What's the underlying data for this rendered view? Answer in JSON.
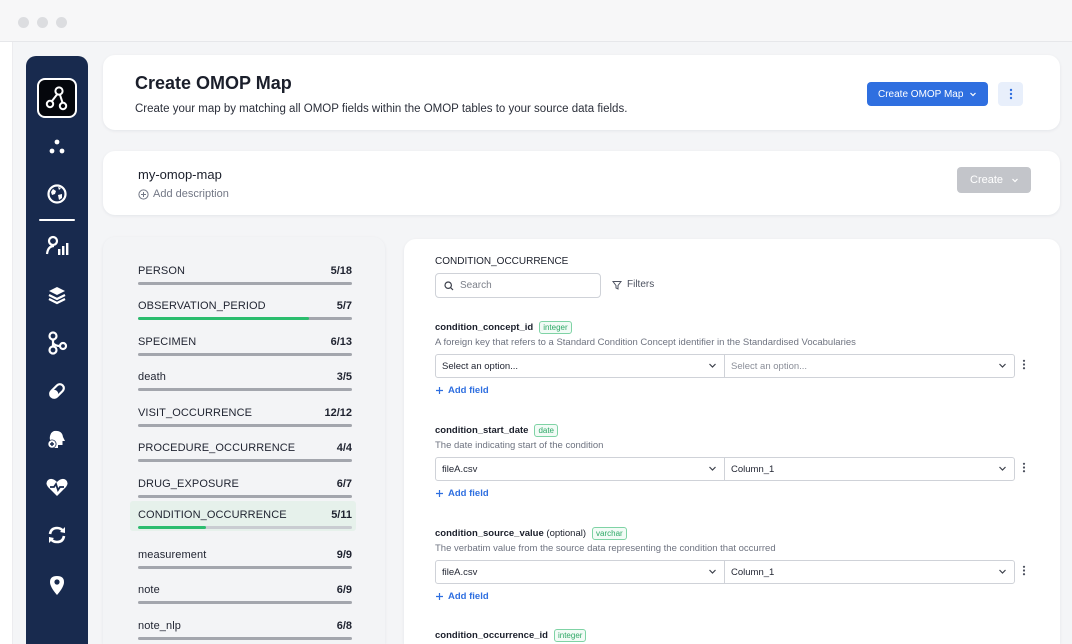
{
  "window": {
    "controls": [
      "close",
      "minimize",
      "maximize"
    ]
  },
  "sidebar": {
    "logo_icon": "graph-nodes-icon",
    "items": [
      {
        "icon": "dots-cluster-icon"
      },
      {
        "icon": "globe-icon"
      },
      {
        "icon": "person-chart-icon"
      },
      {
        "icon": "layers-icon"
      },
      {
        "icon": "map-route-icon"
      },
      {
        "icon": "pill-icon"
      },
      {
        "icon": "head-add-icon"
      },
      {
        "icon": "heart-icon"
      },
      {
        "icon": "sync-icon"
      },
      {
        "icon": "location-pin-icon"
      }
    ]
  },
  "header": {
    "title": "Create OMOP Map",
    "subtitle": "Create your map by matching all OMOP fields within the OMOP tables to your source data fields.",
    "primary_button": "Create OMOP Map",
    "accent_color": "#2f6fe0"
  },
  "map": {
    "name": "my-omop-map",
    "add_description": "Add description",
    "create_button": "Create"
  },
  "tables": [
    {
      "name": "PERSON",
      "count": "5/18",
      "progress": 0.0
    },
    {
      "name": "OBSERVATION_PERIOD",
      "count": "5/7",
      "progress": 0.8
    },
    {
      "name": "SPECIMEN",
      "count": "6/13",
      "progress": 0.0
    },
    {
      "name": "death",
      "count": "3/5",
      "progress": 0.0
    },
    {
      "name": "VISIT_OCCURRENCE",
      "count": "12/12",
      "progress": 0.0
    },
    {
      "name": "PROCEDURE_OCCURRENCE",
      "count": "4/4",
      "progress": 0.0
    },
    {
      "name": "DRUG_EXPOSURE",
      "count": "6/7",
      "progress": 0.0
    },
    {
      "name": "CONDITION_OCCURRENCE",
      "count": "5/11",
      "progress": 0.32,
      "active": true
    },
    {
      "name": "measurement",
      "count": "9/9",
      "progress": 0.0
    },
    {
      "name": "note",
      "count": "6/9",
      "progress": 0.0
    },
    {
      "name": "note_nlp",
      "count": "6/8",
      "progress": 0.0
    }
  ],
  "detail": {
    "section_title": "CONDITION_OCCURRENCE",
    "search_placeholder": "Search",
    "filters_label": "Filters",
    "add_field_label": "Add field",
    "fields": [
      {
        "name": "condition_concept_id",
        "suffix": "",
        "type": "integer",
        "description": "A foreign key that refers to a Standard Condition Concept identifier in the Standardised Vocabularies",
        "left_value": "Select an option...",
        "right_value": "Select an option..."
      },
      {
        "name": "condition_start_date",
        "suffix": "",
        "type": "date",
        "description": "The date indicating start of the condition",
        "left_value": "fileA.csv",
        "right_value": "Column_1"
      },
      {
        "name": "condition_source_value",
        "suffix": "(optional)",
        "type": "varchar",
        "description": "The verbatim value from the source data representing the condition that occurred",
        "left_value": "fileA.csv",
        "right_value": "Column_1"
      },
      {
        "name": "condition_occurrence_id",
        "suffix": "",
        "type": "integer",
        "description": "",
        "left_value": "",
        "right_value": ""
      }
    ]
  }
}
